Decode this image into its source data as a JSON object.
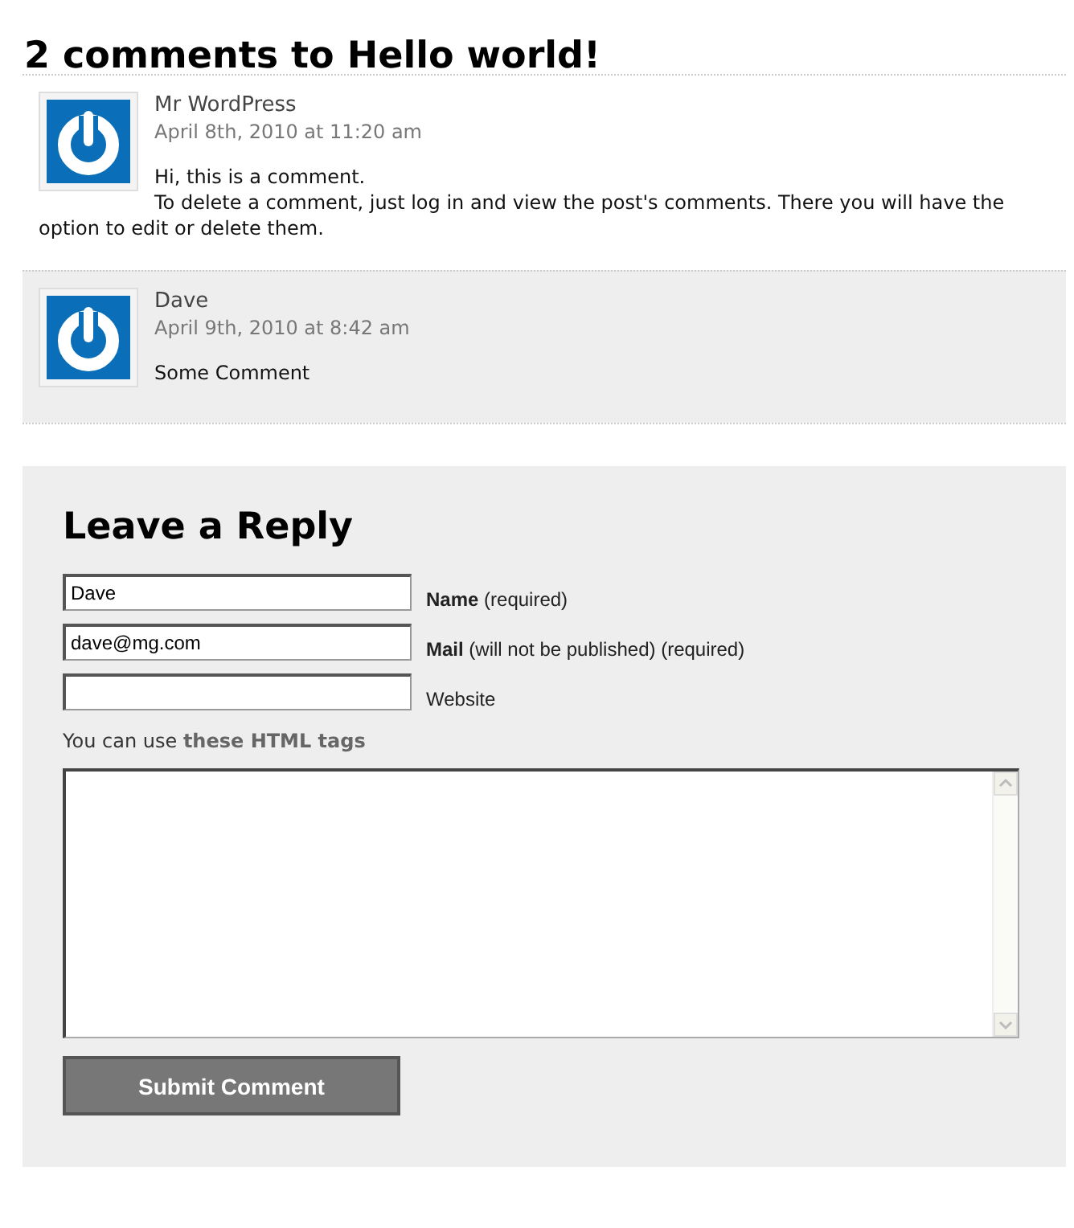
{
  "title": "2 comments to Hello world!",
  "comments": [
    {
      "author": "Mr WordPress",
      "date": "April 8th, 2010 at 11:20 am",
      "highlighted": false,
      "paragraphs": [
        "Hi, this is a comment.",
        "To delete a comment, just log in and view the post's comments. There you will have the option to edit or delete them."
      ]
    },
    {
      "author": "Dave",
      "date": "April 9th, 2010 at 8:42 am",
      "highlighted": true,
      "paragraphs": [
        "Some Comment"
      ]
    }
  ],
  "reply": {
    "heading": "Leave a Reply",
    "fields": [
      {
        "value": "Dave",
        "label": "**Name** (required)"
      },
      {
        "value": "dave@mg.com",
        "label": "**Mail** (will not be published) (required)"
      },
      {
        "label": "Website"
      }
    ],
    "help": {
      "text": "You can use",
      "link": "these HTML tags"
    },
    "submit": "Submit Comment"
  }
}
